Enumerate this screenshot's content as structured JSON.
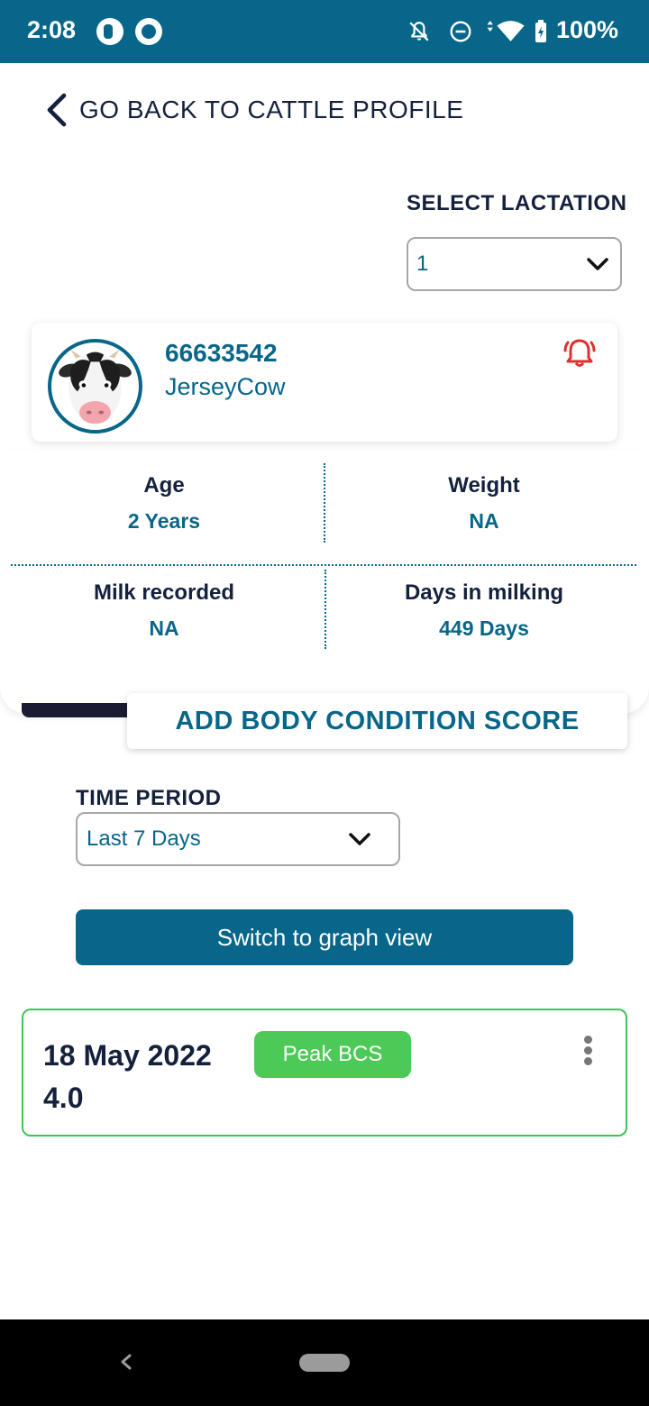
{
  "status_bar": {
    "time": "2:08",
    "battery": "100%",
    "icons": [
      "app-notification-icon",
      "app-sync-icon",
      "notifications-off-icon",
      "do-not-disturb-icon",
      "wifi-icon",
      "battery-charging-icon"
    ]
  },
  "header": {
    "back_label": "GO BACK TO CATTLE PROFILE"
  },
  "lactation": {
    "title": "SELECT LACTATION",
    "value": "1"
  },
  "profile": {
    "id": "66633542",
    "breed": "JerseyCow"
  },
  "stats": [
    {
      "label": "Age",
      "value": "2 Years"
    },
    {
      "label": "Weight",
      "value": "NA"
    },
    {
      "label": "Milk recorded",
      "value": "NA"
    },
    {
      "label": "Days in milking",
      "value": "449 Days"
    }
  ],
  "actions": {
    "add_bcs": "ADD BODY CONDITION SCORE",
    "switch_view": "Switch to graph view"
  },
  "time_period": {
    "title": "TIME PERIOD",
    "value": "Last 7 Days"
  },
  "records": [
    {
      "date": "18 May 2022",
      "score": "4.0",
      "badge": "Peak BCS"
    }
  ],
  "colors": {
    "primary": "#076689",
    "text_dark": "#14213d",
    "success": "#4cc956",
    "alert": "#e0302c"
  }
}
